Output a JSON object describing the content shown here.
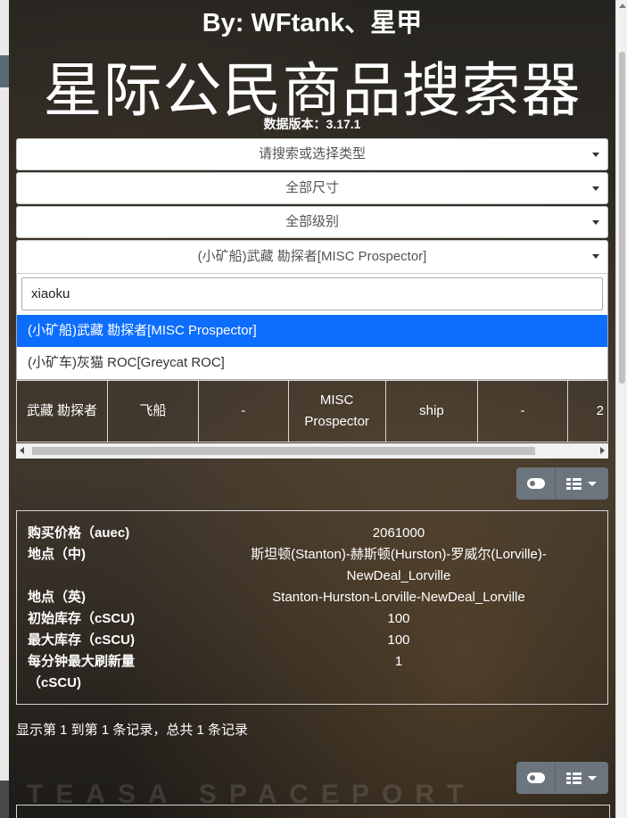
{
  "header": {
    "byline": "By: WFtank、星甲",
    "title": "星际公民商品搜索器",
    "version": "数据版本：3.17.1"
  },
  "filters": {
    "type_placeholder": "请搜索或选择类型",
    "size": "全部尺寸",
    "grade": "全部级别",
    "item": "(小矿船)武藏 勘探者[MISC Prospector]"
  },
  "dropdown": {
    "search_value": "xiaoku",
    "options": [
      "(小矿船)武藏 勘探者[MISC Prospector]",
      "(小矿车)灰猫 ROC[Greycat ROC]"
    ]
  },
  "table": {
    "cells": [
      "武藏 勘探者",
      "飞船",
      "-",
      "MISC Prospector",
      "ship",
      "-",
      "2"
    ]
  },
  "detail": {
    "rows": [
      {
        "k": "购买价格（auec)",
        "v": "2061000"
      },
      {
        "k": "地点（中)",
        "v": "斯坦顿(Stanton)-赫斯顿(Hurston)-罗威尔(Lorville)-NewDeal_Lorville"
      },
      {
        "k": "地点（英)",
        "v": "Stanton-Hurston-Lorville-NewDeal_Lorville"
      },
      {
        "k": "初始库存（cSCU)",
        "v": "100"
      },
      {
        "k": "最大库存（cSCU)",
        "v": "100"
      },
      {
        "k": "每分钟最大刷新量（cSCU)",
        "v": "1"
      }
    ]
  },
  "summary": "显示第 1 到第 1 条记录，总共 1 条记录",
  "watermark": "TEASA SPACEPORT",
  "icons": [
    "toggle-icon",
    "grid-icon",
    "caret-down-icon"
  ]
}
